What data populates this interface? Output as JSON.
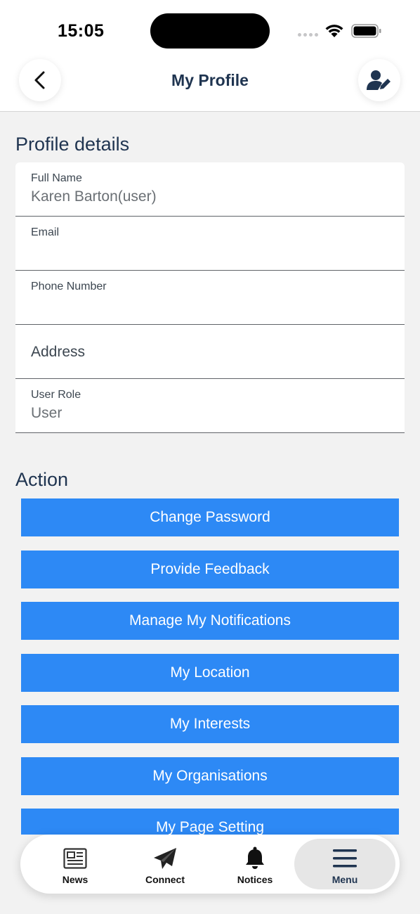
{
  "status_bar": {
    "time": "15:05"
  },
  "header": {
    "title": "My Profile"
  },
  "profile": {
    "section_title": "Profile details",
    "fields": [
      {
        "label": "Full Name",
        "value": "Karen Barton(user)"
      },
      {
        "label": "Email",
        "value": ""
      },
      {
        "label": "Phone Number",
        "value": ""
      },
      {
        "placeholder": "Address"
      },
      {
        "label": "User Role",
        "value": "User"
      }
    ]
  },
  "actions": {
    "section_title": "Action",
    "buttons": [
      "Change Password",
      "Provide Feedback",
      "Manage My Notifications",
      "My Location",
      "My Interests",
      "My Organisations",
      "My Page Setting"
    ]
  },
  "tabs": [
    {
      "label": "News",
      "icon": "newspaper-icon"
    },
    {
      "label": "Connect",
      "icon": "paper-plane-icon"
    },
    {
      "label": "Notices",
      "icon": "bell-icon"
    },
    {
      "label": "Menu",
      "icon": "menu-icon",
      "active": true
    }
  ],
  "colors": {
    "primary_button": "#2d89f5",
    "title_text": "#1f3450",
    "background": "#f2f2f2"
  }
}
